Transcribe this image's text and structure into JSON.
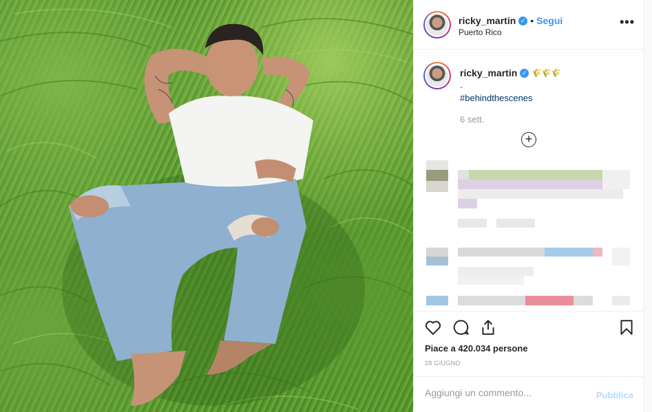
{
  "post": {
    "username": "ricky_martin",
    "follow_label": "Segui",
    "separator": "•",
    "location": "Puerto Rico",
    "more_label": "•••"
  },
  "caption": {
    "username": "ricky_martin",
    "emoji_text": "🌾🌾🌾",
    "line1": ".",
    "hashtag": "#behindthescenes",
    "time_ago": "6 sett."
  },
  "engagement": {
    "likes_text": "Piace a 420.034 persone",
    "date": "28 GIUGNO"
  },
  "comment_box": {
    "placeholder": "Aggiungi un commento...",
    "publish_label": "Pubblica"
  },
  "colors": {
    "accent": "#3897f0",
    "hashtag": "#003569",
    "muted": "#999999",
    "publish_disabled": "#b3dbff"
  }
}
